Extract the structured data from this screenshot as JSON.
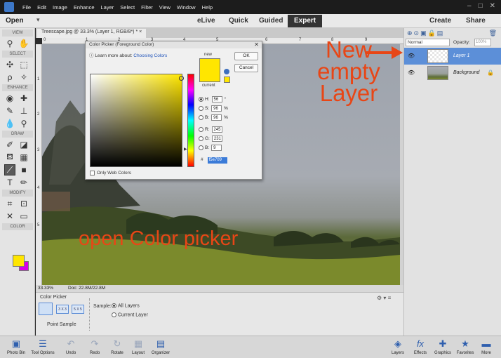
{
  "menubar": {
    "items": [
      "File",
      "Edit",
      "Image",
      "Enhance",
      "Layer",
      "Select",
      "Filter",
      "View",
      "Window",
      "Help"
    ],
    "window_buttons": [
      "–",
      "□",
      "✕"
    ]
  },
  "modebar": {
    "open_label": "Open",
    "modes": [
      "eLive",
      "Quick",
      "Guided",
      "Expert"
    ],
    "active_mode": "Expert",
    "create_label": "Create",
    "share_label": "Share"
  },
  "toolbox": {
    "sections": [
      "VIEW",
      "SELECT",
      "ENHANCE",
      "DRAW",
      "MODIFY",
      "COLOR"
    ],
    "foreground_color": "#ffe600",
    "background_color": "#d800e8"
  },
  "document": {
    "tab_label": "Treescape.jpg @ 33.3% (Layer 1, RGB/8*) * ×",
    "ruler_top_numbers": [
      "0",
      "1",
      "2",
      "3",
      "4",
      "5",
      "6",
      "7",
      "8",
      "9"
    ],
    "ruler_left_numbers": [
      "1",
      "2",
      "3",
      "4",
      "5"
    ],
    "zoom": "33.33%",
    "doc_size": "Doc: 22.8M/22.8M"
  },
  "color_picker": {
    "title": "Color Picker (Foreground Color)",
    "learn_prefix": "Learn more about:",
    "learn_link": "Choosing Colors",
    "new_label": "new",
    "current_label": "current",
    "ok_label": "OK",
    "cancel_label": "Cancel",
    "fields": [
      {
        "label": "H:",
        "value": "56",
        "unit": "°",
        "selected": true
      },
      {
        "label": "S:",
        "value": "96",
        "unit": "%",
        "selected": false
      },
      {
        "label": "B:",
        "value": "96",
        "unit": "%",
        "selected": false
      },
      {
        "label": "R:",
        "value": "245",
        "unit": "",
        "selected": false
      },
      {
        "label": "G:",
        "value": "231",
        "unit": "",
        "selected": false
      },
      {
        "label": "B:",
        "value": "9",
        "unit": "",
        "selected": false
      }
    ],
    "hex_prefix": "#",
    "hex_value": "f5e709",
    "only_web_colors": "Only Web Colors",
    "color_hex": "#ffe600"
  },
  "tool_options": {
    "title": "Color Picker",
    "sample_sizes": [
      "",
      "3 X 3",
      "5 X 5"
    ],
    "point_sample": "Point Sample",
    "sample_label": "Sample:",
    "all_layers": "All Layers",
    "current_layer": "Current Layer"
  },
  "layers_panel": {
    "blend_mode": "Normal",
    "opacity_label": "Opacity:",
    "opacity_value": "100%",
    "layers": [
      {
        "name": "Layer 1",
        "active": true
      },
      {
        "name": "Background",
        "active": false
      }
    ]
  },
  "annotations": {
    "new_empty_layer": "New empty Layer",
    "open_color_picker": "open Color picker",
    "color": "#e84616"
  },
  "bottombar": {
    "left_items": [
      {
        "label": "Photo Bin",
        "icon": "photo-bin-icon"
      },
      {
        "label": "Tool Options",
        "icon": "tool-options-icon"
      },
      {
        "label": "Undo",
        "icon": "undo-icon"
      },
      {
        "label": "Redo",
        "icon": "redo-icon"
      },
      {
        "label": "Rotate",
        "icon": "rotate-icon"
      },
      {
        "label": "Layout",
        "icon": "layout-icon"
      },
      {
        "label": "Organizer",
        "icon": "organizer-icon"
      }
    ],
    "right_items": [
      {
        "label": "Layers",
        "icon": "layers-icon"
      },
      {
        "label": "Effects",
        "icon": "effects-icon"
      },
      {
        "label": "Graphics",
        "icon": "graphics-icon"
      },
      {
        "label": "Favorites",
        "icon": "favorites-icon"
      },
      {
        "label": "More",
        "icon": "more-icon"
      }
    ]
  }
}
